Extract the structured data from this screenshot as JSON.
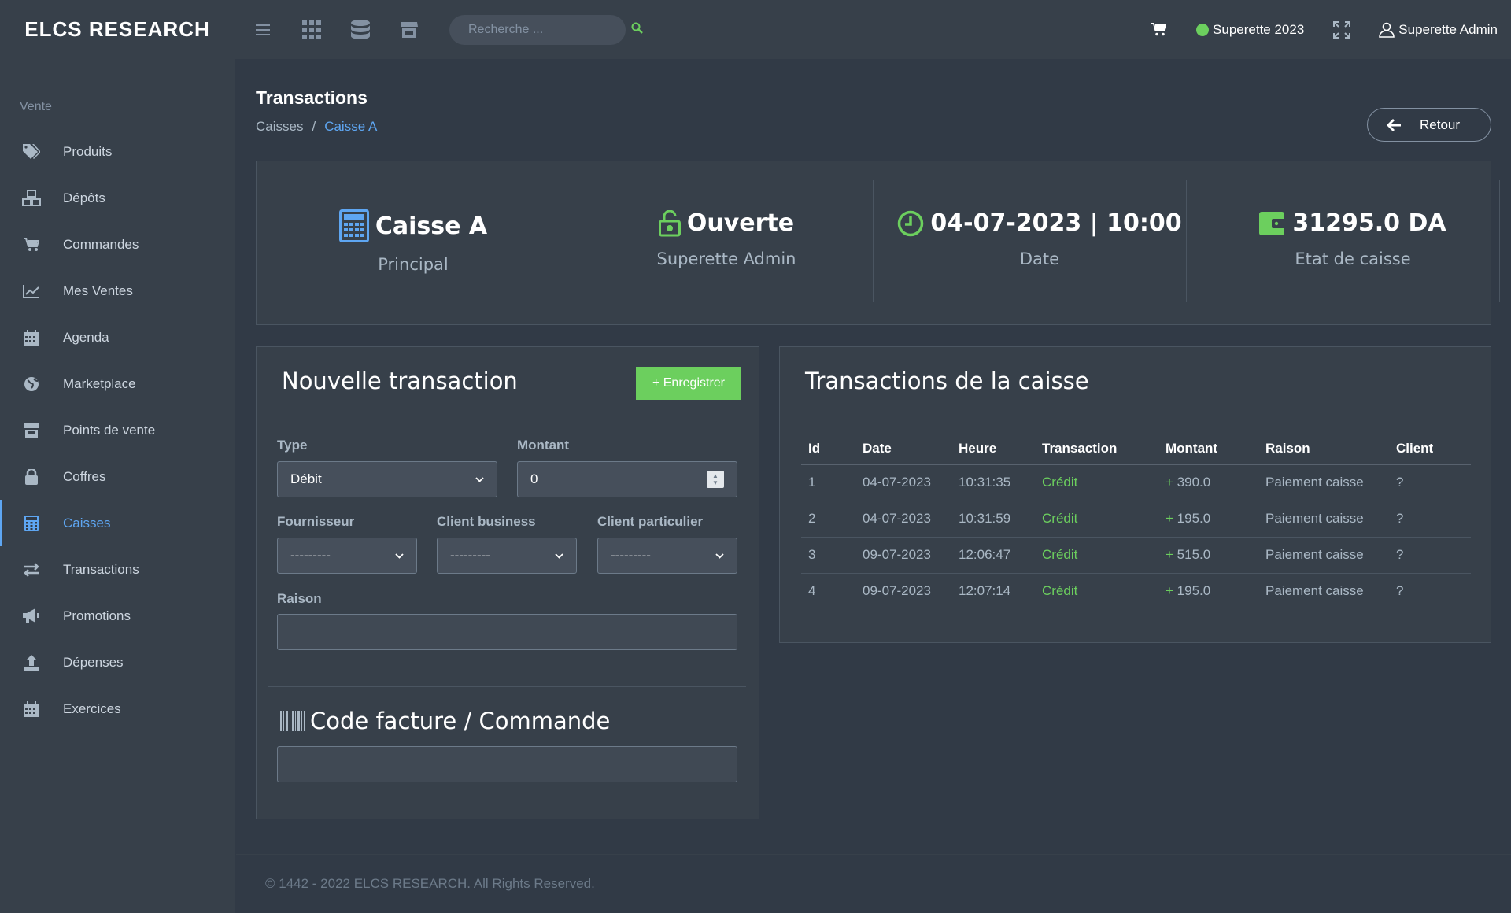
{
  "app": {
    "brand": "ELCS RESEARCH"
  },
  "topbar": {
    "search_placeholder": "Recherche ...",
    "store_label": "Superette 2023",
    "user_label": "Superette Admin",
    "status_color": "#6ccf5e"
  },
  "sidebar": {
    "section": "Vente",
    "items": [
      {
        "label": "Produits",
        "icon": "tags-icon"
      },
      {
        "label": "Dépôts",
        "icon": "boxes-icon"
      },
      {
        "label": "Commandes",
        "icon": "cart-icon"
      },
      {
        "label": "Mes Ventes",
        "icon": "chart-line-icon"
      },
      {
        "label": "Agenda",
        "icon": "calendar-icon"
      },
      {
        "label": "Marketplace",
        "icon": "globe-icon"
      },
      {
        "label": "Points de vente",
        "icon": "store-icon"
      },
      {
        "label": "Coffres",
        "icon": "lock-icon"
      },
      {
        "label": "Caisses",
        "icon": "calculator-icon",
        "active": true
      },
      {
        "label": "Transactions",
        "icon": "exchange-icon"
      },
      {
        "label": "Promotions",
        "icon": "bullhorn-icon"
      },
      {
        "label": "Dépenses",
        "icon": "upload-icon"
      },
      {
        "label": "Exercices",
        "icon": "calendar-grid-icon"
      }
    ]
  },
  "page": {
    "title": "Transactions",
    "breadcrumb": [
      "Caisses",
      "/",
      "Caisse A"
    ],
    "back_label": "Retour"
  },
  "stats": {
    "caisse": {
      "value": "Caisse A",
      "label": "Principal"
    },
    "status": {
      "value": "Ouverte",
      "label": "Superette Admin"
    },
    "date": {
      "value": "04-07-2023 | 10:00",
      "label": "Date"
    },
    "balance": {
      "value": "31295.0 DA",
      "label": "Etat de caisse"
    }
  },
  "form": {
    "title": "Nouvelle transaction",
    "save_label": "+ Enregistrer",
    "type_label": "Type",
    "type_value": "Débit",
    "amount_label": "Montant",
    "amount_value": "0",
    "supplier_label": "Fournisseur",
    "supplier_value": "---------",
    "business_label": "Client business",
    "business_value": "---------",
    "particular_label": "Client particulier",
    "particular_value": "---------",
    "reason_label": "Raison",
    "invoice_title": "Code facture / Commande"
  },
  "transactions": {
    "title": "Transactions de la caisse",
    "columns": [
      "Id",
      "Date",
      "Heure",
      "Transaction",
      "Montant",
      "Raison",
      "Client"
    ],
    "rows": [
      {
        "id": "1",
        "date": "04-07-2023",
        "heure": "10:31:35",
        "transaction": "Crédit",
        "sign": "+",
        "montant": "390.0",
        "raison": "Paiement caisse",
        "client": "?"
      },
      {
        "id": "2",
        "date": "04-07-2023",
        "heure": "10:31:59",
        "transaction": "Crédit",
        "sign": "+",
        "montant": "195.0",
        "raison": "Paiement caisse",
        "client": "?"
      },
      {
        "id": "3",
        "date": "09-07-2023",
        "heure": "12:06:47",
        "transaction": "Crédit",
        "sign": "+",
        "montant": "515.0",
        "raison": "Paiement caisse",
        "client": "?"
      },
      {
        "id": "4",
        "date": "09-07-2023",
        "heure": "12:07:14",
        "transaction": "Crédit",
        "sign": "+",
        "montant": "195.0",
        "raison": "Paiement caisse",
        "client": "?"
      }
    ]
  },
  "footer": {
    "text": "© 1442 - 2022 ELCS RESEARCH. All Rights Reserved."
  }
}
